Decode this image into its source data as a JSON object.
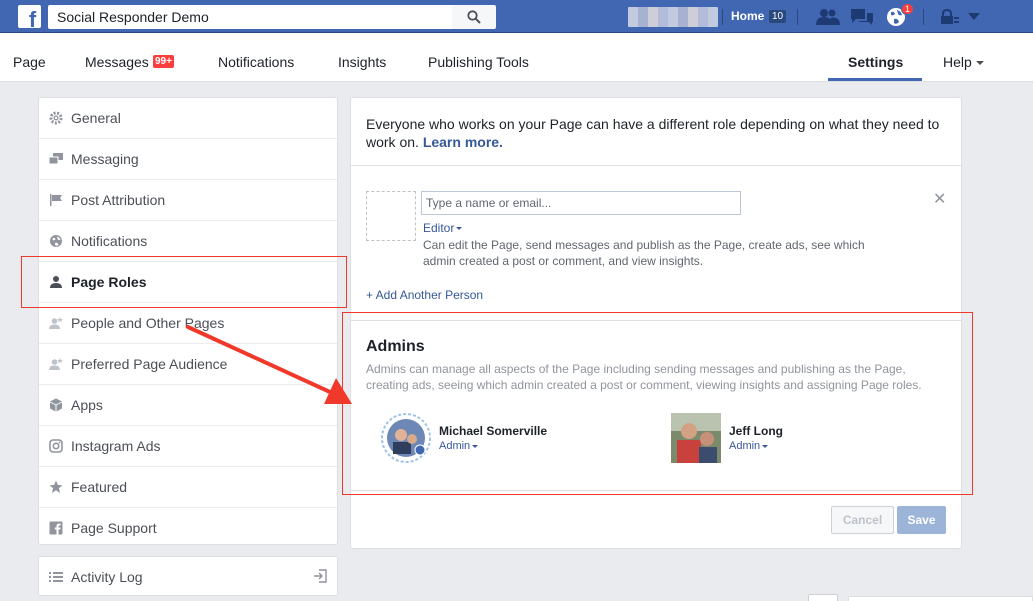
{
  "topbar": {
    "search_value": "Social Responder Demo",
    "home_label": "Home",
    "home_count": "10",
    "notification_count": "1"
  },
  "pagenav": {
    "items": [
      "Page",
      "Messages",
      "Notifications",
      "Insights",
      "Publishing Tools",
      "Settings",
      "Help"
    ],
    "messages_badge": "99+",
    "active": "Settings"
  },
  "menu": {
    "items": [
      {
        "label": "General",
        "icon": "gear-icon"
      },
      {
        "label": "Messaging",
        "icon": "chat-icon"
      },
      {
        "label": "Post Attribution",
        "icon": "flag-icon"
      },
      {
        "label": "Notifications",
        "icon": "globe-icon"
      },
      {
        "label": "Page Roles",
        "icon": "person-icon"
      },
      {
        "label": "People and Other Pages",
        "icon": "people-star-icon"
      },
      {
        "label": "Preferred Page Audience",
        "icon": "people-star-icon"
      },
      {
        "label": "Apps",
        "icon": "cube-icon"
      },
      {
        "label": "Instagram Ads",
        "icon": "instagram-icon"
      },
      {
        "label": "Featured",
        "icon": "star-icon"
      },
      {
        "label": "Page Support",
        "icon": "facebook-square-icon"
      }
    ],
    "active": "Page Roles",
    "activity_log": "Activity Log"
  },
  "main": {
    "intro_text": "Everyone who works on your Page can have a different role depending on what they need to work on.",
    "learn_more": "Learn more.",
    "name_placeholder": "Type a name or email...",
    "role_value": "Editor",
    "role_desc": "Can edit the Page, send messages and publish as the Page, create ads, see which admin created a post or comment, and view insights.",
    "add_another": "+ Add Another Person",
    "admins_title": "Admins",
    "admins_desc": "Admins can manage all aspects of the Page including sending messages and publishing as the Page, creating ads, seeing which admin created a post or comment, viewing insights and assigning Page roles.",
    "admins": [
      {
        "name": "Michael Somerville",
        "role": "Admin"
      },
      {
        "name": "Jeff Long",
        "role": "Admin"
      }
    ],
    "cancel_label": "Cancel",
    "save_label": "Save"
  },
  "colors": {
    "brand_blue": "#4267b2",
    "link_blue": "#365899",
    "badge_red": "#fa3e3e",
    "annotation_red": "#f0392b"
  }
}
